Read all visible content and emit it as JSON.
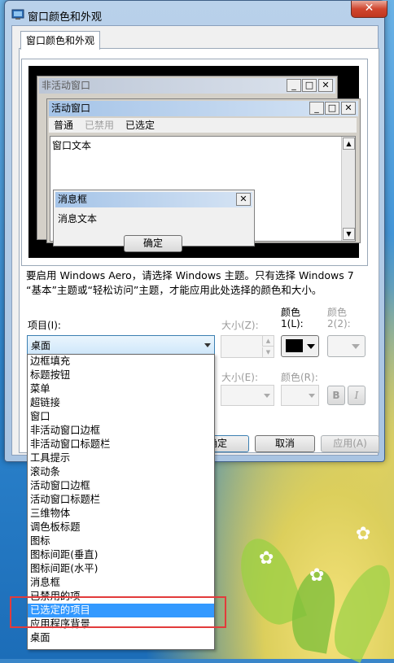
{
  "window": {
    "title": "窗口颜色和外观",
    "close": "✕"
  },
  "tab": {
    "label": "窗口颜色和外观"
  },
  "preview": {
    "inactive_title": "非活动窗口",
    "active_title": "活动窗口",
    "menu": {
      "normal": "普通",
      "disabled": "已禁用",
      "selected": "已选定"
    },
    "window_text": "窗口文本",
    "msgbox_title": "消息框",
    "msgbox_text": "消息文本",
    "ok": "确定"
  },
  "description": "要启用 Windows Aero，请选择 Windows 主题。只有选择 Windows 7 “基本”主题或“轻松访问”主题，才能应用此处选择的颜色和大小。",
  "labels": {
    "item": "项目(I):",
    "size_z": "大小(Z):",
    "color1_line1": "颜色",
    "color1_line2": "1(L):",
    "color2_line1": "颜色",
    "color2_line2": "2(2):",
    "font_size": "大小(E):",
    "font_color": "颜色(R):",
    "bold": "B",
    "italic": "I"
  },
  "item_select": {
    "value": "桌面"
  },
  "buttons": {
    "ok": "确定",
    "cancel": "取消",
    "apply": "应用(A)"
  },
  "dropdown_items": [
    "边框填充",
    "标题按钮",
    "菜单",
    "超链接",
    "窗口",
    "非活动窗口边框",
    "非活动窗口标题栏",
    "工具提示",
    "滚动条",
    "活动窗口边框",
    "活动窗口标题栏",
    "三维物体",
    "调色板标题",
    "图标",
    "图标间距(垂直)",
    "图标间距(水平)",
    "消息框",
    "已禁用的项",
    "已选定的项目",
    "应用程序背景",
    "桌面"
  ],
  "selected_index": 18,
  "colors": {
    "color1": "#000000",
    "highlight": "#3399ff",
    "annotation": "#e23b3b"
  }
}
